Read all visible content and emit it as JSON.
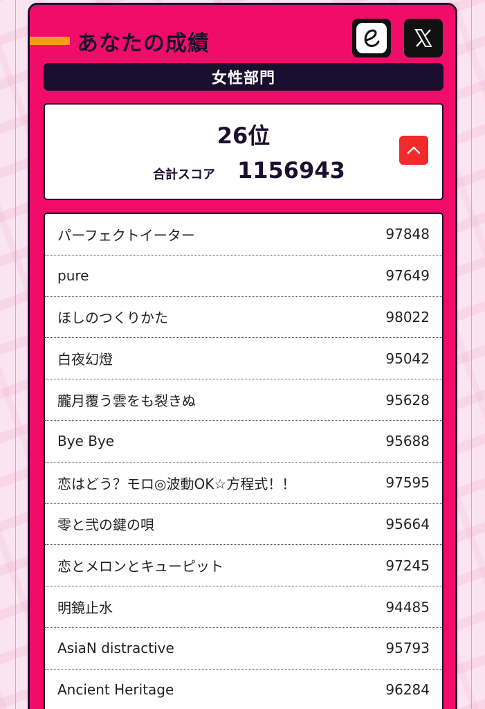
{
  "header": {
    "title": "あなたの成績",
    "share_icons": [
      {
        "name": "e-icon",
        "glyph": "e"
      },
      {
        "name": "x-icon",
        "glyph": "𝕏"
      }
    ]
  },
  "division": "女性部門",
  "result": {
    "rank": "26位",
    "total_label": "合計スコア",
    "total_value": "1156943"
  },
  "songs": [
    {
      "title": "パーフェクトイーター",
      "score": "97848"
    },
    {
      "title": "pure",
      "score": "97649"
    },
    {
      "title": "ほしのつくりかた",
      "score": "98022"
    },
    {
      "title": "白夜幻燈",
      "score": "95042"
    },
    {
      "title": "朧月覆う雲をも裂きぬ",
      "score": "95628"
    },
    {
      "title": "Bye Bye",
      "score": "95688"
    },
    {
      "title": "恋はどう？モロ◎波動OK☆方程式！！",
      "score": "97595"
    },
    {
      "title": "零と弐の鍵の唄",
      "score": "95664"
    },
    {
      "title": "恋とメロンとキューピット",
      "score": "97245"
    },
    {
      "title": "明鏡止水",
      "score": "94485"
    },
    {
      "title": "AsiaN distractive",
      "score": "95793"
    },
    {
      "title": "Ancient Heritage",
      "score": "96284"
    }
  ],
  "colors": {
    "card": "#f20c6a",
    "dark": "#1a0f2e",
    "accent": "#ff9a18",
    "collapse": "#f22a2a"
  }
}
